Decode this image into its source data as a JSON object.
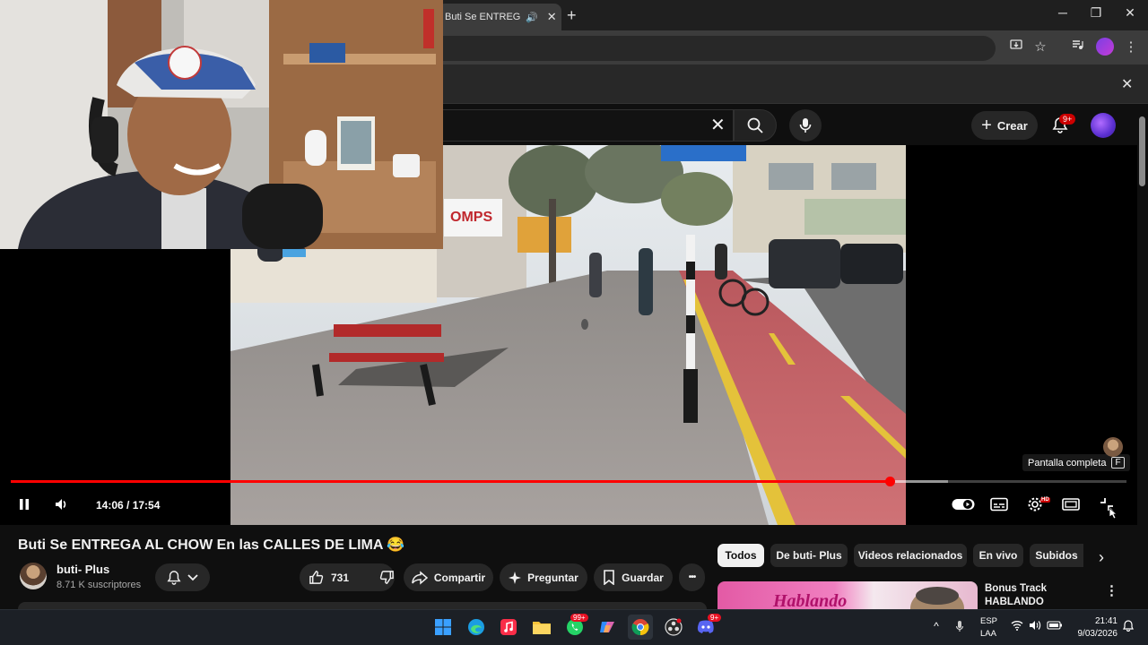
{
  "browser": {
    "tab_title": "Buti Se ENTREGA AL CHOW",
    "new_tab_symbol": "+",
    "window_controls": {
      "minimize": "─",
      "maximize": "❐",
      "close": "✕"
    }
  },
  "header": {
    "search_clear": "✕",
    "create_label": "Crear",
    "notification_count": "9+"
  },
  "player": {
    "current_time": "14:06",
    "duration": "17:54",
    "time_display": "14:06 / 17:54",
    "progress_fraction": 0.7877,
    "buffered_fraction": 0.84,
    "fullscreen_tooltip": "Pantalla completa",
    "fullscreen_key": "F",
    "hd_badge": "HD"
  },
  "video": {
    "title": "Buti Se ENTREGA AL CHOW En las CALLES DE LIMA 😂",
    "channel_name": "buti- Plus",
    "subscribers": "8.71 K suscriptores",
    "likes": "731",
    "share_label": "Compartir",
    "ask_label": "Preguntar",
    "save_label": "Guardar",
    "more_label": "•••"
  },
  "chips": [
    "Todos",
    "De buti- Plus",
    "Videos relacionados",
    "En vivo",
    "Subidos"
  ],
  "recommendation": {
    "title": "Bonus Track HABLANDO HUEVADAS - Undécim...",
    "menu": "⋮",
    "thumb_text": "Hablando"
  },
  "taskbar": {
    "lang_line1": "ESP",
    "lang_line2": "LAA",
    "time": "21:41",
    "date": "9/03/2026",
    "whatsapp_badge": "99+",
    "discord_badge": "9+"
  },
  "colors": {
    "accent": "#ff0000",
    "background": "#0f0f0f",
    "surface": "#272727",
    "bike_lane": "#c8555b"
  }
}
